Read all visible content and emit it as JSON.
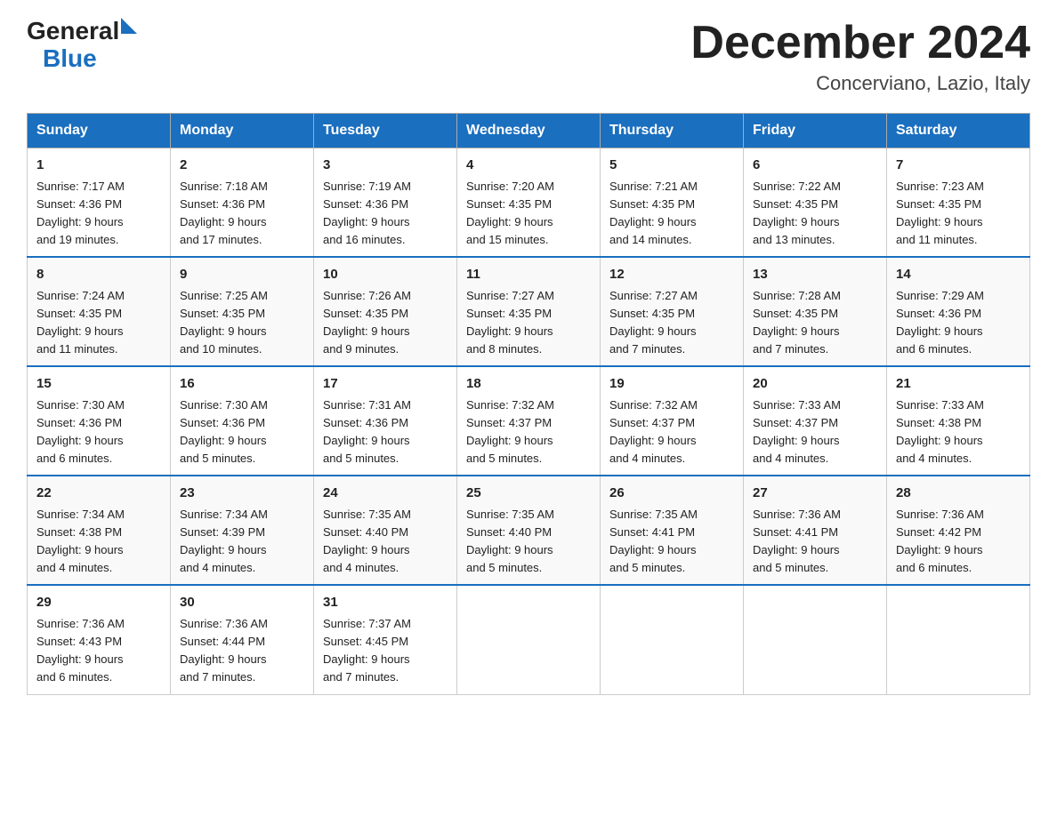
{
  "header": {
    "logo_text_general": "General",
    "logo_text_blue": "Blue",
    "month_title": "December 2024",
    "location": "Concerviano, Lazio, Italy"
  },
  "days_of_week": [
    "Sunday",
    "Monday",
    "Tuesday",
    "Wednesday",
    "Thursday",
    "Friday",
    "Saturday"
  ],
  "weeks": [
    [
      {
        "day": "1",
        "sunrise": "7:17 AM",
        "sunset": "4:36 PM",
        "daylight": "9 hours and 19 minutes."
      },
      {
        "day": "2",
        "sunrise": "7:18 AM",
        "sunset": "4:36 PM",
        "daylight": "9 hours and 17 minutes."
      },
      {
        "day": "3",
        "sunrise": "7:19 AM",
        "sunset": "4:36 PM",
        "daylight": "9 hours and 16 minutes."
      },
      {
        "day": "4",
        "sunrise": "7:20 AM",
        "sunset": "4:35 PM",
        "daylight": "9 hours and 15 minutes."
      },
      {
        "day": "5",
        "sunrise": "7:21 AM",
        "sunset": "4:35 PM",
        "daylight": "9 hours and 14 minutes."
      },
      {
        "day": "6",
        "sunrise": "7:22 AM",
        "sunset": "4:35 PM",
        "daylight": "9 hours and 13 minutes."
      },
      {
        "day": "7",
        "sunrise": "7:23 AM",
        "sunset": "4:35 PM",
        "daylight": "9 hours and 11 minutes."
      }
    ],
    [
      {
        "day": "8",
        "sunrise": "7:24 AM",
        "sunset": "4:35 PM",
        "daylight": "9 hours and 11 minutes."
      },
      {
        "day": "9",
        "sunrise": "7:25 AM",
        "sunset": "4:35 PM",
        "daylight": "9 hours and 10 minutes."
      },
      {
        "day": "10",
        "sunrise": "7:26 AM",
        "sunset": "4:35 PM",
        "daylight": "9 hours and 9 minutes."
      },
      {
        "day": "11",
        "sunrise": "7:27 AM",
        "sunset": "4:35 PM",
        "daylight": "9 hours and 8 minutes."
      },
      {
        "day": "12",
        "sunrise": "7:27 AM",
        "sunset": "4:35 PM",
        "daylight": "9 hours and 7 minutes."
      },
      {
        "day": "13",
        "sunrise": "7:28 AM",
        "sunset": "4:35 PM",
        "daylight": "9 hours and 7 minutes."
      },
      {
        "day": "14",
        "sunrise": "7:29 AM",
        "sunset": "4:36 PM",
        "daylight": "9 hours and 6 minutes."
      }
    ],
    [
      {
        "day": "15",
        "sunrise": "7:30 AM",
        "sunset": "4:36 PM",
        "daylight": "9 hours and 6 minutes."
      },
      {
        "day": "16",
        "sunrise": "7:30 AM",
        "sunset": "4:36 PM",
        "daylight": "9 hours and 5 minutes."
      },
      {
        "day": "17",
        "sunrise": "7:31 AM",
        "sunset": "4:36 PM",
        "daylight": "9 hours and 5 minutes."
      },
      {
        "day": "18",
        "sunrise": "7:32 AM",
        "sunset": "4:37 PM",
        "daylight": "9 hours and 5 minutes."
      },
      {
        "day": "19",
        "sunrise": "7:32 AM",
        "sunset": "4:37 PM",
        "daylight": "9 hours and 4 minutes."
      },
      {
        "day": "20",
        "sunrise": "7:33 AM",
        "sunset": "4:37 PM",
        "daylight": "9 hours and 4 minutes."
      },
      {
        "day": "21",
        "sunrise": "7:33 AM",
        "sunset": "4:38 PM",
        "daylight": "9 hours and 4 minutes."
      }
    ],
    [
      {
        "day": "22",
        "sunrise": "7:34 AM",
        "sunset": "4:38 PM",
        "daylight": "9 hours and 4 minutes."
      },
      {
        "day": "23",
        "sunrise": "7:34 AM",
        "sunset": "4:39 PM",
        "daylight": "9 hours and 4 minutes."
      },
      {
        "day": "24",
        "sunrise": "7:35 AM",
        "sunset": "4:40 PM",
        "daylight": "9 hours and 4 minutes."
      },
      {
        "day": "25",
        "sunrise": "7:35 AM",
        "sunset": "4:40 PM",
        "daylight": "9 hours and 5 minutes."
      },
      {
        "day": "26",
        "sunrise": "7:35 AM",
        "sunset": "4:41 PM",
        "daylight": "9 hours and 5 minutes."
      },
      {
        "day": "27",
        "sunrise": "7:36 AM",
        "sunset": "4:41 PM",
        "daylight": "9 hours and 5 minutes."
      },
      {
        "day": "28",
        "sunrise": "7:36 AM",
        "sunset": "4:42 PM",
        "daylight": "9 hours and 6 minutes."
      }
    ],
    [
      {
        "day": "29",
        "sunrise": "7:36 AM",
        "sunset": "4:43 PM",
        "daylight": "9 hours and 6 minutes."
      },
      {
        "day": "30",
        "sunrise": "7:36 AM",
        "sunset": "4:44 PM",
        "daylight": "9 hours and 7 minutes."
      },
      {
        "day": "31",
        "sunrise": "7:37 AM",
        "sunset": "4:45 PM",
        "daylight": "9 hours and 7 minutes."
      },
      null,
      null,
      null,
      null
    ]
  ],
  "labels": {
    "sunrise": "Sunrise:",
    "sunset": "Sunset:",
    "daylight": "Daylight:"
  },
  "colors": {
    "header_bg": "#1a6fbf",
    "header_text": "#ffffff",
    "border": "#aaaaaa",
    "row_border": "#1a6fbf"
  }
}
